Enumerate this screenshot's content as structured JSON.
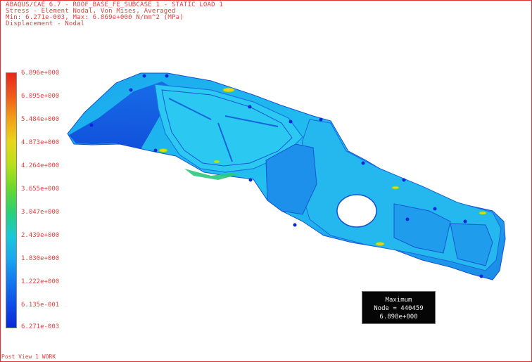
{
  "header": {
    "line1": "ABAQUS/CAE 6.7 - ROOF_BASE_FE_SUBCASE 1 - STATIC LOAD 1",
    "line2": "Stress - Element Nodal, Von Mises, Averaged",
    "line3": "Min: 6.271e-003, Max: 6.869e+000 N/mm^2 (MPa)",
    "line4": "Displacement - Nodal"
  },
  "legend": {
    "labels": [
      "6.896e+000",
      "6.095e+000",
      "5.484e+000",
      "4.873e+000",
      "4.264e+000",
      "3.655e+000",
      "3.047e+000",
      "2.439e+000",
      "1.830e+000",
      "1.222e+000",
      "6.135e-001",
      "6.271e-003"
    ],
    "colors": {
      "max": "#e8281a",
      "mid": "#28d07a",
      "min": "#0a28d8"
    }
  },
  "maxbox": {
    "title": "Maximum",
    "node": "Node = 440459",
    "value": "6.898e+000"
  },
  "status": {
    "text": "Post View 1 WORK"
  }
}
